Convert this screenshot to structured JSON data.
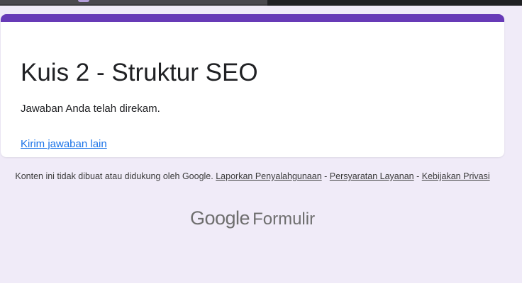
{
  "form": {
    "title": "Kuis 2 - Struktur SEO",
    "confirmation_message": "Jawaban Anda telah direkam.",
    "submit_another_label": "Kirim jawaban lain"
  },
  "footer": {
    "disclaimer": "Konten ini tidak dibuat atau didukung oleh Google.",
    "report_abuse_label": "Laporkan Penyalahgunaan",
    "separator_1": " - ",
    "terms_label": "Persyaratan Layanan",
    "separator_2": " - ",
    "privacy_label": "Kebijakan Privasi"
  },
  "brand": {
    "google_word": "Google",
    "product_word": "Formulir"
  },
  "colors": {
    "accent": "#673ab7",
    "background": "#f0ebf8",
    "link": "#1a73e8"
  }
}
